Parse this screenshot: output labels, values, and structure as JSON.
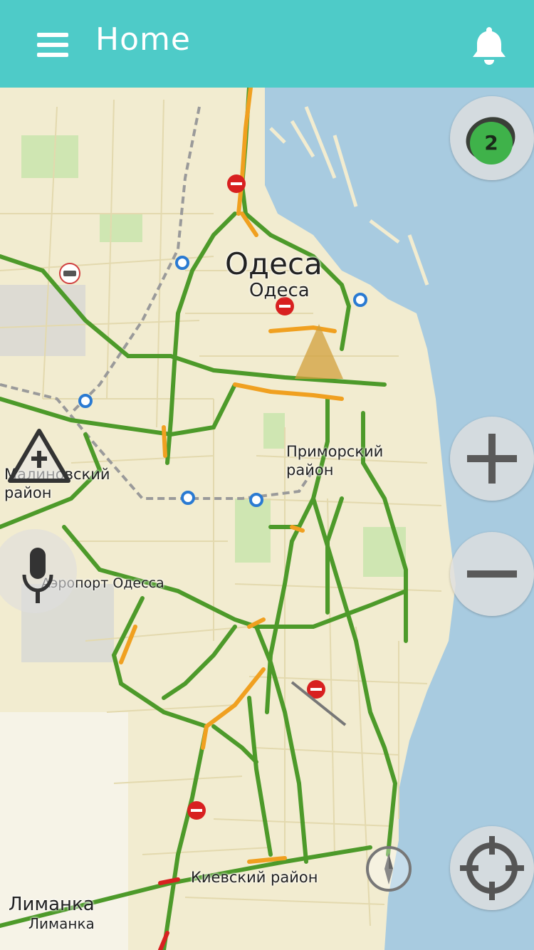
{
  "header": {
    "title": "Home",
    "menu_icon": "hamburger-menu-icon",
    "notification_icon": "bell-icon"
  },
  "map": {
    "city_label": "Одеса",
    "city_label_small": "Одеса",
    "district_primorsky": "Приморский район",
    "district_malinovsky": "Малиновский район",
    "airport_label": "Аэропорт Одесса",
    "district_kievsky": "Киевский район",
    "limanka_label": "Лиманка",
    "limanka_small": "Лиманка"
  },
  "controls": {
    "route_badge_count": "2",
    "zoom_in_icon": "plus-icon",
    "zoom_out_icon": "minus-icon",
    "locate_icon": "crosshair-icon",
    "compass_icon": "compass-icon",
    "voice_icon": "microphone-icon",
    "warning_icon": "road-warning-icon"
  },
  "colors": {
    "appbar": "#4ecbc8",
    "traffic_green": "#4d9a2a",
    "traffic_orange": "#f0a020",
    "traffic_red": "#d82020",
    "water": "#a8cbe0",
    "land": "#f2ecd0"
  }
}
